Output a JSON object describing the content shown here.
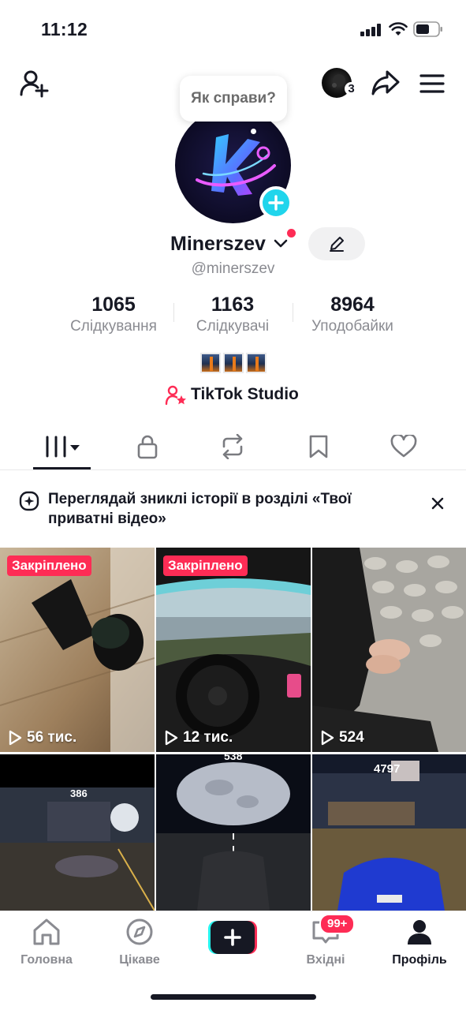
{
  "status_bar": {
    "time": "11:12"
  },
  "tooltip": {
    "text": "Як справи?"
  },
  "story": {
    "count": "3"
  },
  "profile": {
    "display_name": "Minerszev",
    "username": "@minerszev"
  },
  "stats": [
    {
      "value": "1065",
      "label": "Слідкування"
    },
    {
      "value": "1163",
      "label": "Слідкувачі"
    },
    {
      "value": "8964",
      "label": "Уподобайки"
    }
  ],
  "studio": {
    "label": "TikTok Studio"
  },
  "banner": {
    "text": "Переглядай зниклі історії в розділі «Твої приватні відео»"
  },
  "videos": [
    {
      "pinned": "Закріплено",
      "views": "56 тис."
    },
    {
      "pinned": "Закріплено",
      "views": "12 тис."
    },
    {
      "views": "524"
    },
    {
      "overlay": "386"
    },
    {
      "overlay": "538"
    },
    {
      "overlay": "4797"
    }
  ],
  "nav": {
    "items": [
      {
        "label": "Головна",
        "icon": "home-icon"
      },
      {
        "label": "Цікаве",
        "icon": "compass-icon"
      },
      {
        "label": "",
        "icon": "plus-icon"
      },
      {
        "label": "Вхідні",
        "icon": "inbox-icon"
      },
      {
        "label": "Профіль",
        "icon": "profile-icon"
      }
    ],
    "inbox_badge": "99+"
  },
  "colors": {
    "accent": "#fe2c55",
    "cyan": "#20d5ec",
    "text": "#161823",
    "muted": "#8a8b91"
  }
}
